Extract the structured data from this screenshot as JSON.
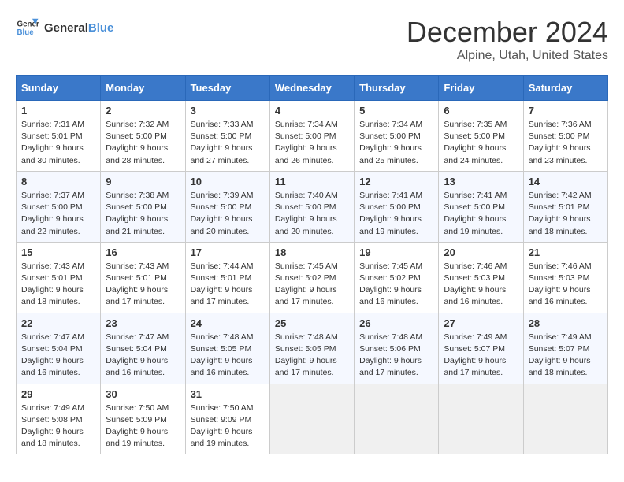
{
  "logo": {
    "line1": "General",
    "line2": "Blue"
  },
  "title": {
    "month_year": "December 2024",
    "location": "Alpine, Utah, United States"
  },
  "headers": [
    "Sunday",
    "Monday",
    "Tuesday",
    "Wednesday",
    "Thursday",
    "Friday",
    "Saturday"
  ],
  "weeks": [
    [
      {
        "day": "1",
        "info": "Sunrise: 7:31 AM\nSunset: 5:01 PM\nDaylight: 9 hours\nand 30 minutes."
      },
      {
        "day": "2",
        "info": "Sunrise: 7:32 AM\nSunset: 5:00 PM\nDaylight: 9 hours\nand 28 minutes."
      },
      {
        "day": "3",
        "info": "Sunrise: 7:33 AM\nSunset: 5:00 PM\nDaylight: 9 hours\nand 27 minutes."
      },
      {
        "day": "4",
        "info": "Sunrise: 7:34 AM\nSunset: 5:00 PM\nDaylight: 9 hours\nand 26 minutes."
      },
      {
        "day": "5",
        "info": "Sunrise: 7:34 AM\nSunset: 5:00 PM\nDaylight: 9 hours\nand 25 minutes."
      },
      {
        "day": "6",
        "info": "Sunrise: 7:35 AM\nSunset: 5:00 PM\nDaylight: 9 hours\nand 24 minutes."
      },
      {
        "day": "7",
        "info": "Sunrise: 7:36 AM\nSunset: 5:00 PM\nDaylight: 9 hours\nand 23 minutes."
      }
    ],
    [
      {
        "day": "8",
        "info": "Sunrise: 7:37 AM\nSunset: 5:00 PM\nDaylight: 9 hours\nand 22 minutes."
      },
      {
        "day": "9",
        "info": "Sunrise: 7:38 AM\nSunset: 5:00 PM\nDaylight: 9 hours\nand 21 minutes."
      },
      {
        "day": "10",
        "info": "Sunrise: 7:39 AM\nSunset: 5:00 PM\nDaylight: 9 hours\nand 20 minutes."
      },
      {
        "day": "11",
        "info": "Sunrise: 7:40 AM\nSunset: 5:00 PM\nDaylight: 9 hours\nand 20 minutes."
      },
      {
        "day": "12",
        "info": "Sunrise: 7:41 AM\nSunset: 5:00 PM\nDaylight: 9 hours\nand 19 minutes."
      },
      {
        "day": "13",
        "info": "Sunrise: 7:41 AM\nSunset: 5:00 PM\nDaylight: 9 hours\nand 19 minutes."
      },
      {
        "day": "14",
        "info": "Sunrise: 7:42 AM\nSunset: 5:01 PM\nDaylight: 9 hours\nand 18 minutes."
      }
    ],
    [
      {
        "day": "15",
        "info": "Sunrise: 7:43 AM\nSunset: 5:01 PM\nDaylight: 9 hours\nand 18 minutes."
      },
      {
        "day": "16",
        "info": "Sunrise: 7:43 AM\nSunset: 5:01 PM\nDaylight: 9 hours\nand 17 minutes."
      },
      {
        "day": "17",
        "info": "Sunrise: 7:44 AM\nSunset: 5:01 PM\nDaylight: 9 hours\nand 17 minutes."
      },
      {
        "day": "18",
        "info": "Sunrise: 7:45 AM\nSunset: 5:02 PM\nDaylight: 9 hours\nand 17 minutes."
      },
      {
        "day": "19",
        "info": "Sunrise: 7:45 AM\nSunset: 5:02 PM\nDaylight: 9 hours\nand 16 minutes."
      },
      {
        "day": "20",
        "info": "Sunrise: 7:46 AM\nSunset: 5:03 PM\nDaylight: 9 hours\nand 16 minutes."
      },
      {
        "day": "21",
        "info": "Sunrise: 7:46 AM\nSunset: 5:03 PM\nDaylight: 9 hours\nand 16 minutes."
      }
    ],
    [
      {
        "day": "22",
        "info": "Sunrise: 7:47 AM\nSunset: 5:04 PM\nDaylight: 9 hours\nand 16 minutes."
      },
      {
        "day": "23",
        "info": "Sunrise: 7:47 AM\nSunset: 5:04 PM\nDaylight: 9 hours\nand 16 minutes."
      },
      {
        "day": "24",
        "info": "Sunrise: 7:48 AM\nSunset: 5:05 PM\nDaylight: 9 hours\nand 16 minutes."
      },
      {
        "day": "25",
        "info": "Sunrise: 7:48 AM\nSunset: 5:05 PM\nDaylight: 9 hours\nand 17 minutes."
      },
      {
        "day": "26",
        "info": "Sunrise: 7:48 AM\nSunset: 5:06 PM\nDaylight: 9 hours\nand 17 minutes."
      },
      {
        "day": "27",
        "info": "Sunrise: 7:49 AM\nSunset: 5:07 PM\nDaylight: 9 hours\nand 17 minutes."
      },
      {
        "day": "28",
        "info": "Sunrise: 7:49 AM\nSunset: 5:07 PM\nDaylight: 9 hours\nand 18 minutes."
      }
    ],
    [
      {
        "day": "29",
        "info": "Sunrise: 7:49 AM\nSunset: 5:08 PM\nDaylight: 9 hours\nand 18 minutes."
      },
      {
        "day": "30",
        "info": "Sunrise: 7:50 AM\nSunset: 5:09 PM\nDaylight: 9 hours\nand 19 minutes."
      },
      {
        "day": "31",
        "info": "Sunrise: 7:50 AM\nSunset: 9:09 PM\nDaylight: 9 hours\nand 19 minutes."
      },
      {
        "day": "",
        "info": ""
      },
      {
        "day": "",
        "info": ""
      },
      {
        "day": "",
        "info": ""
      },
      {
        "day": "",
        "info": ""
      }
    ]
  ]
}
